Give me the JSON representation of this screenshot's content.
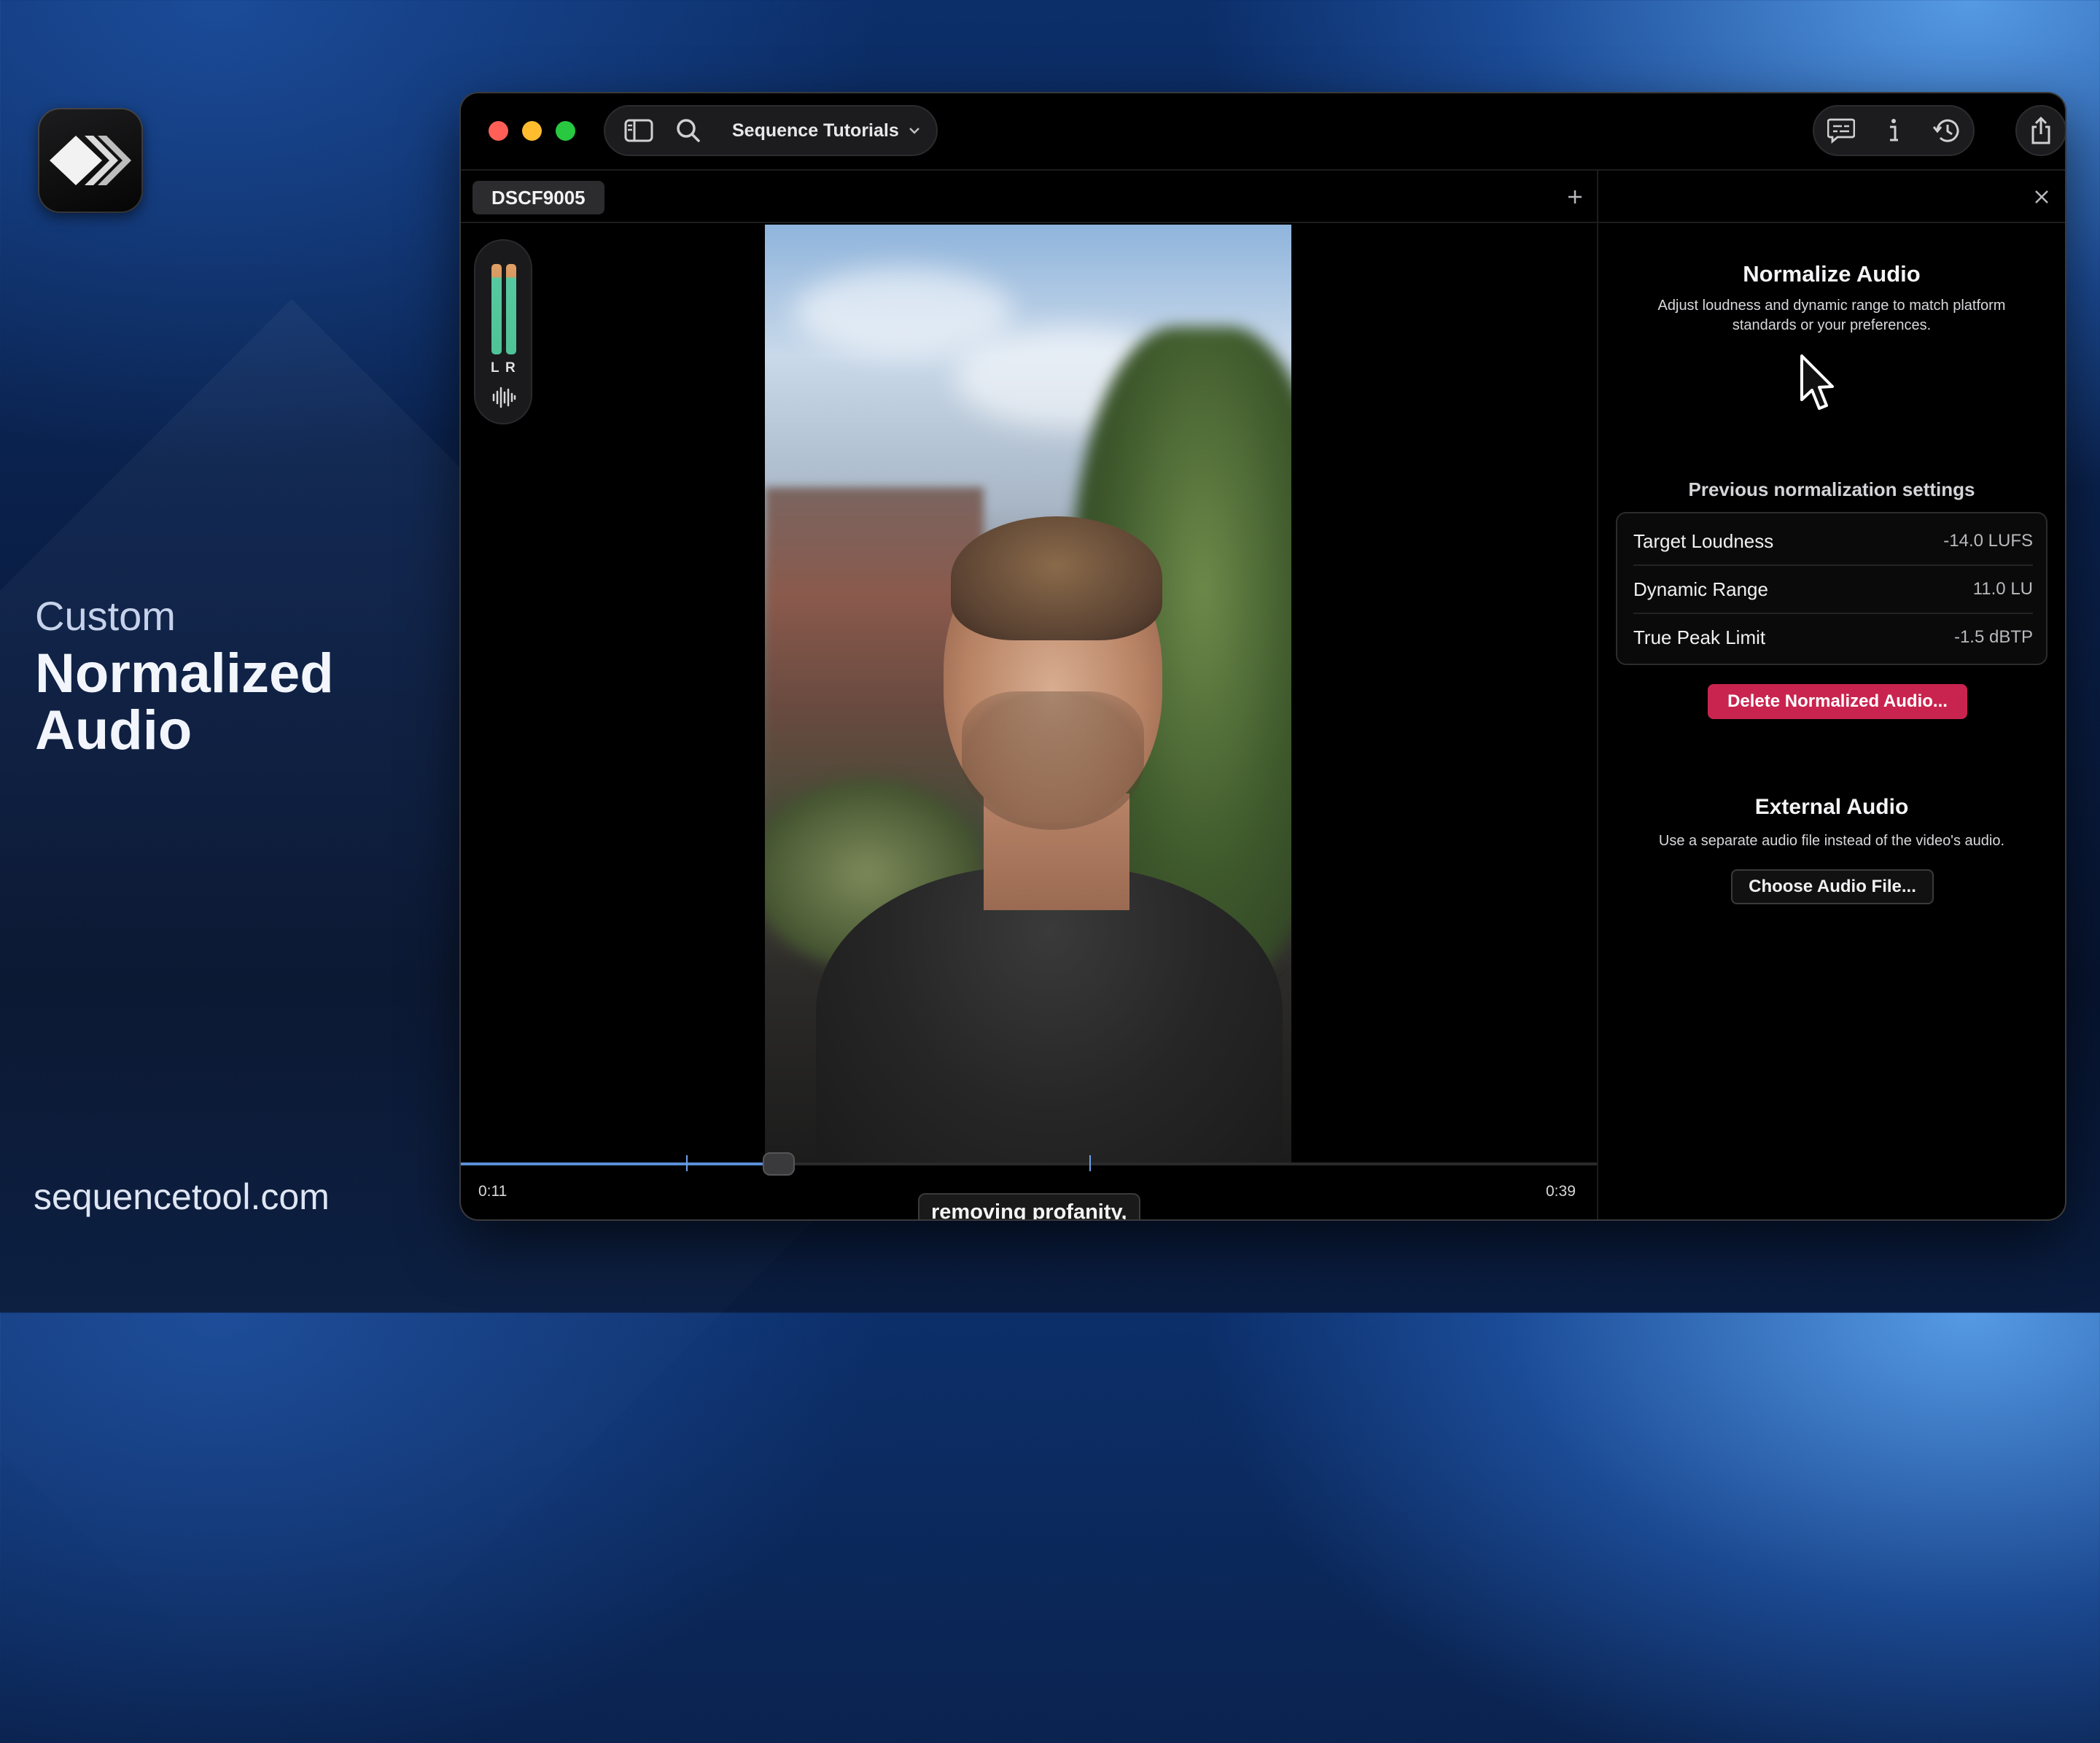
{
  "promo": {
    "subtitle": "Custom",
    "title_line1": "Normalized",
    "title_line2": "Audio",
    "website": "sequencetool.com"
  },
  "toolbar": {
    "project_name": "Sequence Tutorials",
    "traffic_colors": [
      "#ff5f57",
      "#febc2e",
      "#28c840"
    ],
    "icons": [
      "sidebar-toggle-icon",
      "search-icon",
      "chevron-down-icon",
      "captions-icon",
      "info-icon",
      "history-icon",
      "share-icon"
    ]
  },
  "clip": {
    "tab_name": "DSCF9005",
    "meter_left_label": "L",
    "meter_right_label": "R",
    "caption": "removing profanity,",
    "time_current": "0:11",
    "time_total": "0:39",
    "progress_fraction": 0.28
  },
  "panel": {
    "normalize": {
      "title": "Normalize Audio",
      "description": "Adjust loudness and dynamic range to match platform standards or your preferences.",
      "previous_heading": "Previous normalization settings",
      "rows": [
        {
          "label": "Target Loudness",
          "value": "-14.0 LUFS"
        },
        {
          "label": "Dynamic Range",
          "value": "11.0 LU"
        },
        {
          "label": "True Peak Limit",
          "value": "-1.5 dBTP"
        }
      ],
      "delete_button": "Delete Normalized Audio..."
    },
    "external": {
      "title": "External Audio",
      "description": "Use a separate audio file instead of the video's audio.",
      "choose_button": "Choose Audio File..."
    }
  },
  "colors": {
    "accent_blue": "#5b8fd8",
    "delete_red": "#c9244f",
    "meter_green": "#4fc297",
    "meter_orange": "#e0a066"
  }
}
